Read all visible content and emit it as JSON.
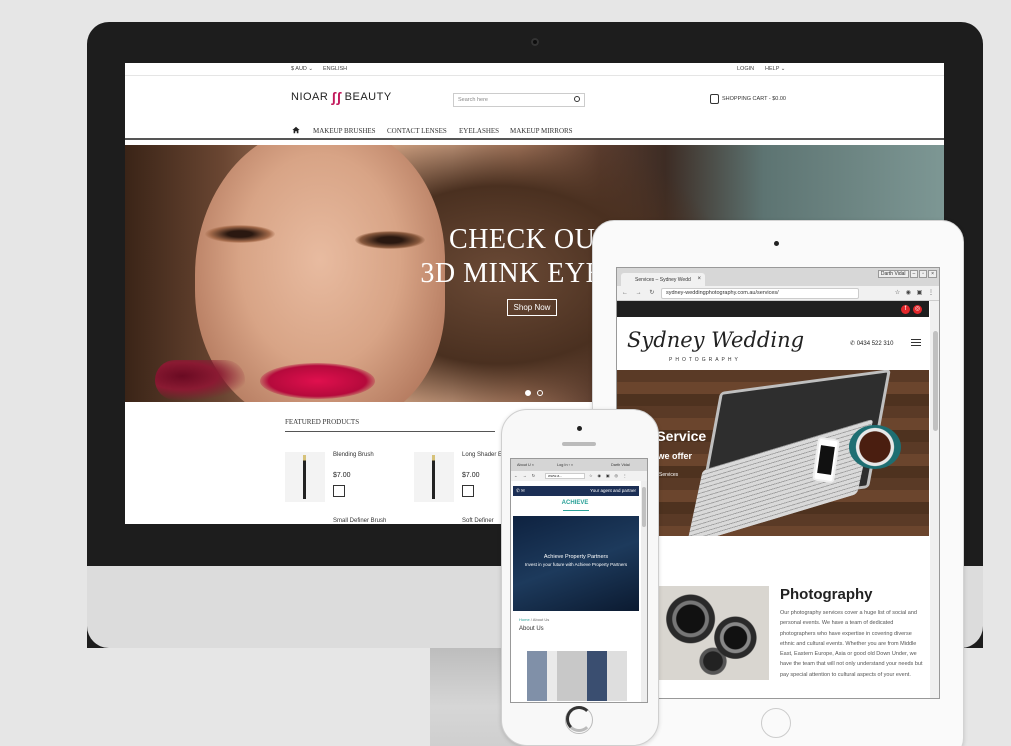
{
  "imac_site": {
    "topbar": {
      "currency": "$ AUD ⌄",
      "language": "ENGLISH",
      "login": "LOGIN",
      "help": "HELP ⌄"
    },
    "logo": {
      "left": "NIOAR",
      "right": "BEAUTY"
    },
    "search": {
      "placeholder": "Search here"
    },
    "cart": {
      "label": "SHOPPING CART - $0.00"
    },
    "nav": {
      "items": [
        "MAKEUP BRUSHES",
        "CONTACT LENSES",
        "EYELASHES",
        "MAKEUP MIRRORS"
      ]
    },
    "hero": {
      "line1": "CHECK OUT",
      "line2": "3D MINK EYELA",
      "button": "Shop Now"
    },
    "featured_title": "FEATURED PRODUCTS",
    "products": [
      {
        "name": "Blending Brush",
        "price": "$7.00"
      },
      {
        "name": "Long Shader E",
        "price": "$7.00"
      },
      {
        "name": "Small Definer Brush",
        "price": ""
      },
      {
        "name": "Soft Definer",
        "price": ""
      }
    ]
  },
  "ipad_site": {
    "tab_title": "Services – Sydney Wedd",
    "window_label": "Darth Vidal",
    "address_url": "sydney-weddingphotography.com.au/services/",
    "logo": {
      "script": "Sydney Wedding",
      "sub": "PHOTOGRAPHY"
    },
    "phone": "0434 522 310",
    "hero": {
      "title": "r Service",
      "subtitle": "at we offer",
      "crumb": "Services"
    },
    "section": {
      "title": "Photography",
      "text": "Our photography services cover a huge list of social and personal events. We have a team of dedicated photographers who have expertise in covering diverse ethnic and cultural events. Whether you are from Middle East, Eastern Europe, Asia or good old Down Under, we have the team that will not only understand your needs but pay special attention to cultural aspects of your event."
    }
  },
  "iphone_site": {
    "tab1": "About U ×",
    "tab2": "Log In ‹ ×",
    "window_label": "Darth Vidal",
    "address_url": "www.a...",
    "topbar_text": "Your agent and partner",
    "logo": "ACHIEVE",
    "hero": {
      "line1": "Achieve Property Partners",
      "line2": "Invest in your future with Achieve Property Partners"
    },
    "breadcrumb": {
      "home": "Home",
      "separator": " / ",
      "current": "About Us"
    },
    "page_title": "About Us"
  },
  "colors": {
    "nioar_accent": "#c2185b",
    "sydney_social": "#e2262a",
    "achieve_navy": "#1c2f55",
    "achieve_teal": "#2aa198"
  },
  "icons": [
    "home-icon",
    "search-icon",
    "shopping-bag-icon",
    "cart-icon",
    "phone-icon",
    "menu-icon",
    "facebook-icon",
    "instagram-icon"
  ]
}
